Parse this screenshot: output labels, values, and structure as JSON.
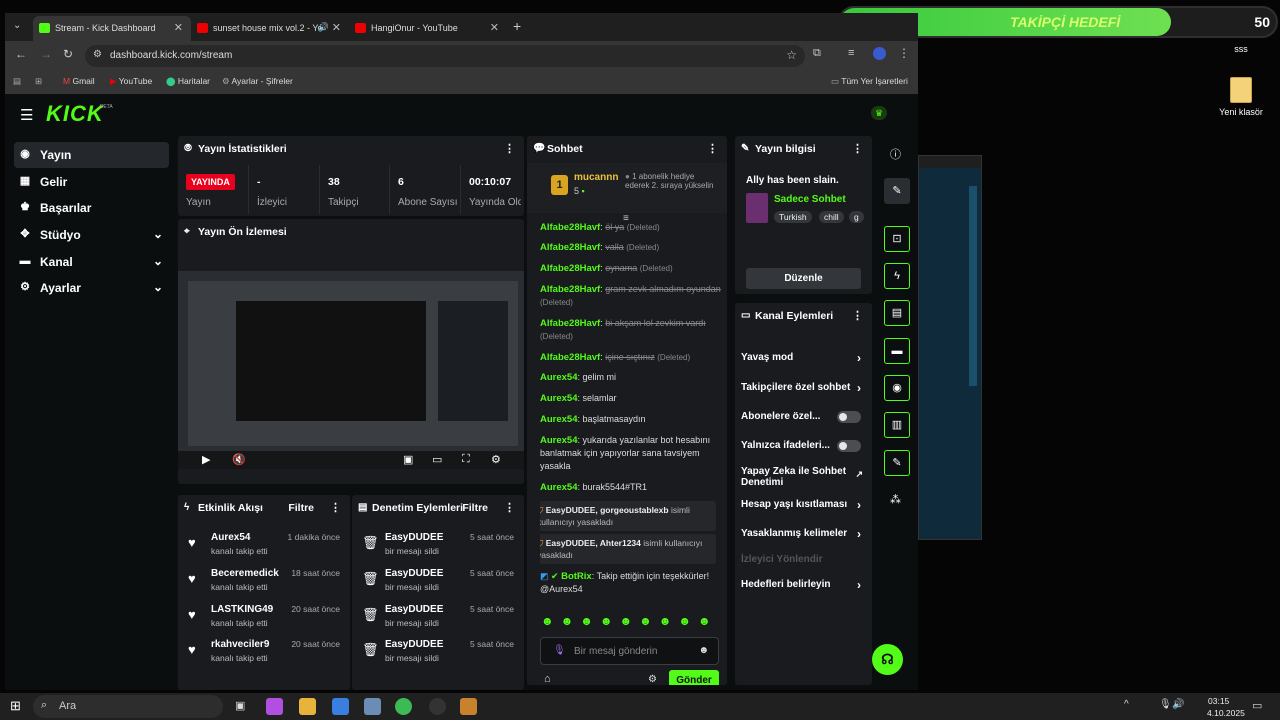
{
  "goal": {
    "current": "38",
    "title": "TAKİPÇİ HEDEFİ",
    "target": "50",
    "progress_fraction": 0.76,
    "label_below": "sss"
  },
  "desktop": {
    "folder_label": "Yeni klasör"
  },
  "browser": {
    "tabs": [
      {
        "label": "Stream - Kick Dashboard",
        "active": true
      },
      {
        "label": "sunset house mix vol.2 - Yo"
      },
      {
        "label": "HangiOnur - YouTube"
      }
    ],
    "new_tab": "+",
    "url": "dashboard.kick.com/stream",
    "bookmarks": [
      "Gmail",
      "YouTube",
      "Haritalar",
      "Ayarlar - Şifreler"
    ],
    "all_bookmarks": "Tüm Yer İşaretleri"
  },
  "kick": {
    "logo": "KICK",
    "logo_beta": "BETA",
    "sidebar": [
      {
        "label": "Yayın",
        "active": true,
        "icon": "broadcast-icon"
      },
      {
        "label": "Gelir",
        "icon": "revenue-icon"
      },
      {
        "label": "Başarılar",
        "icon": "trophy-icon"
      },
      {
        "label": "Stüdyo",
        "icon": "studio-icon",
        "expand": true
      },
      {
        "label": "Kanal",
        "icon": "channel-icon",
        "expand": true
      },
      {
        "label": "Ayarlar",
        "icon": "settings-icon",
        "expand": true
      }
    ],
    "stats": {
      "title": "Yayın İstatistikleri",
      "cells": [
        {
          "value": "YAYINDA",
          "label": "Yayın"
        },
        {
          "value": "-",
          "label": "İzleyici"
        },
        {
          "value": "38",
          "label": "Takipçi"
        },
        {
          "value": "6",
          "label": "Abone Sayısı"
        },
        {
          "value": "00:10:07",
          "label": "Yayında Olduğu"
        }
      ]
    },
    "preview": {
      "title": "Yayın Ön İzlemesi"
    },
    "activity": {
      "title": "Etkinlik Akışı",
      "filter": "Filtre",
      "items": [
        {
          "name": "Aurex54",
          "sub": "kanalı takip etti",
          "time": "1 dakika önce"
        },
        {
          "name": "Beceremedick",
          "sub": "kanalı takip etti",
          "time": "18 saat önce"
        },
        {
          "name": "LASTKING49",
          "sub": "kanalı takip etti",
          "time": "20 saat önce"
        },
        {
          "name": "rkahveciler9",
          "sub": "kanalı takip etti",
          "time": "20 saat önce"
        }
      ]
    },
    "moderation": {
      "title": "Denetim Eylemleri",
      "filter": "Filtre",
      "items": [
        {
          "name": "EasyDUDEE",
          "sub": "bir mesajı sildi",
          "time": "5 saat önce"
        },
        {
          "name": "EasyDUDEE",
          "sub": "bir mesajı sildi",
          "time": "5 saat önce"
        },
        {
          "name": "EasyDUDEE",
          "sub": "bir mesajı sildi",
          "time": "5 saat önce"
        },
        {
          "name": "EasyDUDEE",
          "sub": "bir mesajı sildi",
          "time": "5 saat önce"
        }
      ]
    },
    "chat": {
      "title": "Sohbet",
      "pinned_user": "mucannn",
      "pinned_rank": "1",
      "pinned_count": "5",
      "pinned_text": "1 abonelik hediye ederek 2. sıraya yükselin",
      "deleted_tag": "(Deleted)",
      "messages": [
        {
          "user": "Alfabe28Havf",
          "text": "öl ya",
          "deleted": true
        },
        {
          "user": "Alfabe28Havf",
          "text": "valla",
          "deleted": true
        },
        {
          "user": "Alfabe28Havf",
          "text": "oynama",
          "deleted": true
        },
        {
          "user": "Alfabe28Havf",
          "text": "gram zevk almadım oyundan",
          "deleted": true
        },
        {
          "user": "Alfabe28Havf",
          "text": "bi akşam lol zevkim vardı",
          "deleted": true
        },
        {
          "user": "Alfabe28Havf",
          "text": "içine sıçtınız",
          "deleted": true
        },
        {
          "user": "Aurex54",
          "text": "gelim mi"
        },
        {
          "user": "Aurex54",
          "text": "selamlar"
        },
        {
          "user": "Aurex54",
          "text": "başlatmasaydın"
        },
        {
          "user": "Aurex54",
          "text": "yukarıda yazılanlar bot hesabını banlatmak için yapıyorlar sana tavsiyem yasakla"
        },
        {
          "user": "Aurex54",
          "text": "burak5544#TR1"
        }
      ],
      "mod_events": [
        {
          "bold": "EasyDUDEE, gorgeoustablexb",
          "text": "isimli kullanıcıyı yasakladı"
        },
        {
          "bold": "EasyDUDEE, Ahter1234",
          "text": "isimli kullanıcıyı yasakladı"
        }
      ],
      "bot_message": {
        "user": "BotRix",
        "text": "Takip ettiğin için teşekkürler! @Aurex54"
      },
      "input_placeholder": "Bir mesaj gönderin",
      "send_label": "Gönder"
    },
    "stream_info": {
      "title": "Yayın bilgisi",
      "stream_title": "Ally has been slain.",
      "category": "Sadece Sohbet",
      "tags": [
        "Turkish",
        "chill",
        "g"
      ],
      "edit_label": "Düzenle"
    },
    "channel_actions": {
      "title": "Kanal Eylemleri",
      "items": [
        {
          "label": "Yavaş mod",
          "kind": "arrow"
        },
        {
          "label": "Takipçilere özel sohbet",
          "kind": "arrow"
        },
        {
          "label": "Abonelere özel...",
          "kind": "toggle"
        },
        {
          "label": "Yalnızca ifadeleri...",
          "kind": "toggle"
        },
        {
          "label": "Yapay Zeka ile Sohbet Denetimi",
          "kind": "external"
        },
        {
          "label": "Hesap yaşı kısıtlaması",
          "kind": "arrow"
        },
        {
          "label": "Yasaklanmış kelimeler",
          "kind": "arrow"
        },
        {
          "label": "İzleyici Yönlendir",
          "kind": "disabled"
        },
        {
          "label": "Hedefleri belirleyin",
          "kind": "arrow"
        }
      ]
    }
  },
  "taskbar": {
    "search_placeholder": "Ara",
    "time": "03:15",
    "date": "4.10.2025"
  },
  "colors": {
    "kick_green": "#53fc18",
    "live_red": "#e8001c",
    "panel_bg": "#191b1f",
    "app_bg": "#0b0e0f"
  }
}
